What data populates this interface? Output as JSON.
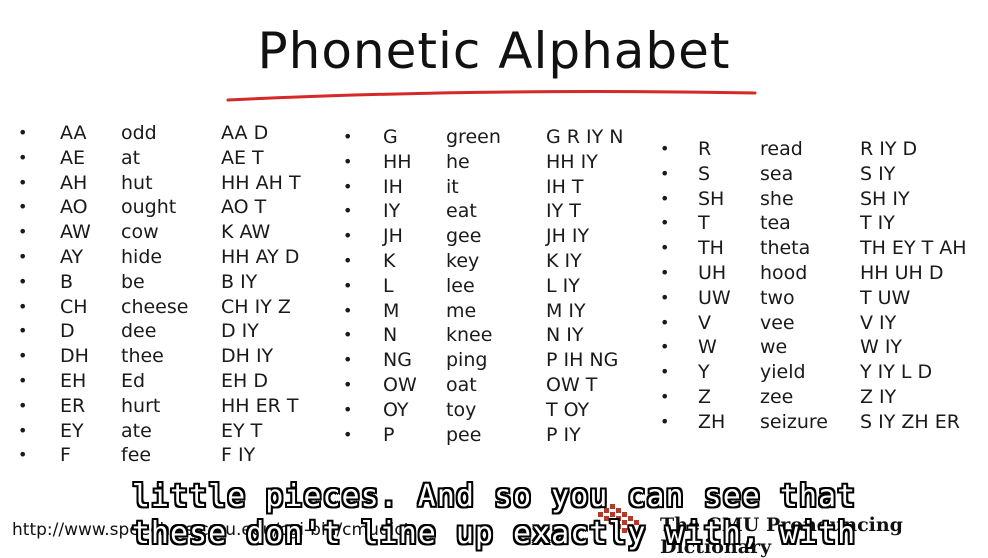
{
  "title": "Phonetic Alphabet",
  "columns": [
    {
      "rows": [
        {
          "phoneme": "AA",
          "word": "odd",
          "pron": "AA D"
        },
        {
          "phoneme": "AE",
          "word": "at",
          "pron": "AE T"
        },
        {
          "phoneme": "AH",
          "word": "hut",
          "pron": "HH AH T"
        },
        {
          "phoneme": "AO",
          "word": "ought",
          "pron": "AO T"
        },
        {
          "phoneme": "AW",
          "word": "cow",
          "pron": "K AW"
        },
        {
          "phoneme": "AY",
          "word": "hide",
          "pron": "HH AY D"
        },
        {
          "phoneme": "B",
          "word": "be",
          "pron": "B IY"
        },
        {
          "phoneme": "CH",
          "word": "cheese",
          "pron": "CH IY Z"
        },
        {
          "phoneme": "D",
          "word": "dee",
          "pron": "D IY"
        },
        {
          "phoneme": "DH",
          "word": "thee",
          "pron": "DH IY"
        },
        {
          "phoneme": "EH",
          "word": "Ed",
          "pron": "EH D"
        },
        {
          "phoneme": "ER",
          "word": "hurt",
          "pron": "HH ER T"
        },
        {
          "phoneme": "EY",
          "word": "ate",
          "pron": "EY T"
        },
        {
          "phoneme": "F",
          "word": "fee",
          "pron": "F IY"
        }
      ]
    },
    {
      "rows": [
        {
          "phoneme": "G",
          "word": "green",
          "pron": "G R IY N"
        },
        {
          "phoneme": "HH",
          "word": "he",
          "pron": "HH IY"
        },
        {
          "phoneme": "IH",
          "word": "it",
          "pron": "IH T"
        },
        {
          "phoneme": "IY",
          "word": "eat",
          "pron": "IY T"
        },
        {
          "phoneme": "JH",
          "word": "gee",
          "pron": "JH IY"
        },
        {
          "phoneme": "K",
          "word": "key",
          "pron": "K IY"
        },
        {
          "phoneme": "L",
          "word": "lee",
          "pron": "L IY"
        },
        {
          "phoneme": "M",
          "word": "me",
          "pron": "M IY"
        },
        {
          "phoneme": "N",
          "word": "knee",
          "pron": "N IY"
        },
        {
          "phoneme": "NG",
          "word": "ping",
          "pron": "P IH NG"
        },
        {
          "phoneme": "OW",
          "word": "oat",
          "pron": "OW T"
        },
        {
          "phoneme": "OY",
          "word": "toy",
          "pron": "T OY"
        },
        {
          "phoneme": "P",
          "word": "pee",
          "pron": "P IY"
        }
      ]
    },
    {
      "rows": [
        {
          "phoneme": "R",
          "word": "read",
          "pron": "R IY D"
        },
        {
          "phoneme": "S",
          "word": "sea",
          "pron": "S IY"
        },
        {
          "phoneme": "SH",
          "word": "she",
          "pron": "SH IY"
        },
        {
          "phoneme": "T",
          "word": "tea",
          "pron": "T IY"
        },
        {
          "phoneme": "TH",
          "word": "theta",
          "pron": "TH EY T AH"
        },
        {
          "phoneme": "UH",
          "word": "hood",
          "pron": "HH UH D"
        },
        {
          "phoneme": "UW",
          "word": "two",
          "pron": "T UW"
        },
        {
          "phoneme": "V",
          "word": "vee",
          "pron": "V IY"
        },
        {
          "phoneme": "W",
          "word": "we",
          "pron": "W IY"
        },
        {
          "phoneme": "Y",
          "word": "yield",
          "pron": "Y IY L D"
        },
        {
          "phoneme": "Z",
          "word": "zee",
          "pron": "Z IY"
        },
        {
          "phoneme": "ZH",
          "word": "seizure",
          "pron": "S IY ZH ER"
        }
      ]
    }
  ],
  "bullet": "•",
  "caption_line1": "little pieces. And so you can see that",
  "caption_line2": "these don't line up exactly with, with",
  "url_text": "http://www.speech.cs.cmu.edu/cgi-bin/cmudict",
  "dict_title": "The CMU Pronouncing Dictionary",
  "colors": {
    "title_underline": "#d62828",
    "logo": "#b33a2a"
  }
}
